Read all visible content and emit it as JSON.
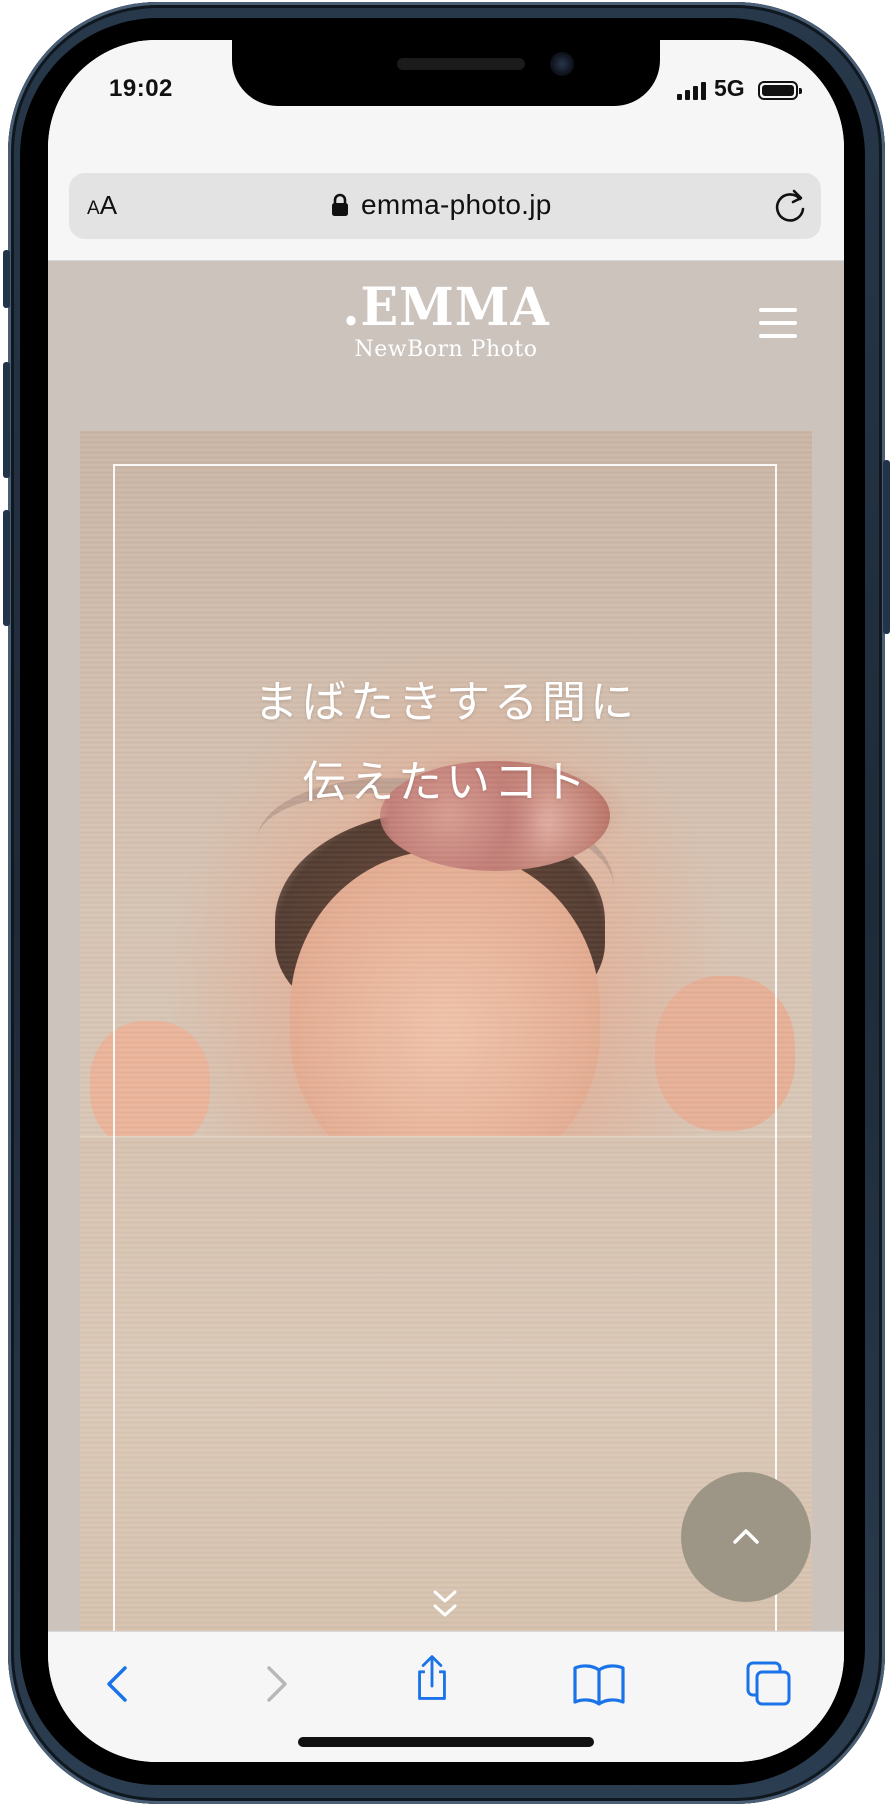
{
  "status_bar": {
    "time": "19:02",
    "network": "5G"
  },
  "browser": {
    "text_size_button": {
      "small": "A",
      "large": "A"
    },
    "url": "emma-photo.jp",
    "icons": [
      "lock-icon",
      "reload-icon"
    ]
  },
  "site": {
    "logo": {
      "main": ".EMMA",
      "sub": "NewBorn Photo"
    },
    "hero": {
      "line1": "まばたきする間に",
      "line2": "伝えたいコト"
    },
    "icons": [
      "hamburger-menu-icon",
      "scroll-down-icon",
      "chevron-up-icon"
    ],
    "colors": {
      "header_bg": "#ccc3bd",
      "back_to_top_bg": "#9d9686"
    }
  },
  "toolbar": {
    "buttons": [
      "back-icon",
      "forward-icon",
      "share-icon",
      "bookmarks-icon",
      "tabs-icon"
    ],
    "colors": {
      "active": "#1a73e8",
      "disabled": "#b8b8b8"
    }
  }
}
